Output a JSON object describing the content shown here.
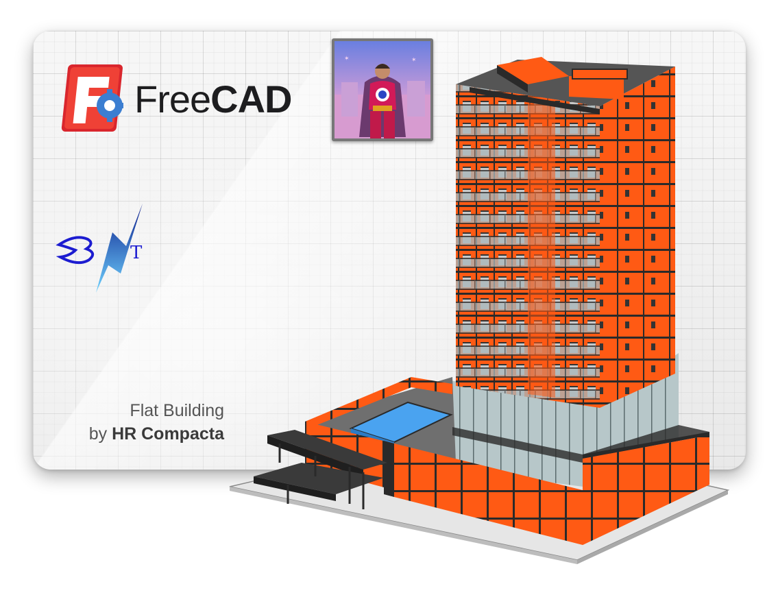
{
  "app": {
    "name_part_1": "Free",
    "name_part_2": "CAD",
    "logo_icon": "freecad-f-gear-icon"
  },
  "splash": {
    "title": "Flat Building",
    "by_prefix": "by",
    "author": "HR Compacta"
  },
  "badges": {
    "avatar_icon": "superhero-avatar-image",
    "bnt_logo_icon": "bnt-signature-logo",
    "bnt_logo_letters": "BNT"
  },
  "colors": {
    "brand_red": "#e63c2f",
    "brand_blue": "#3b7ed1",
    "building_orange": "#ff5a14",
    "pool_blue": "#4aa3f0"
  }
}
